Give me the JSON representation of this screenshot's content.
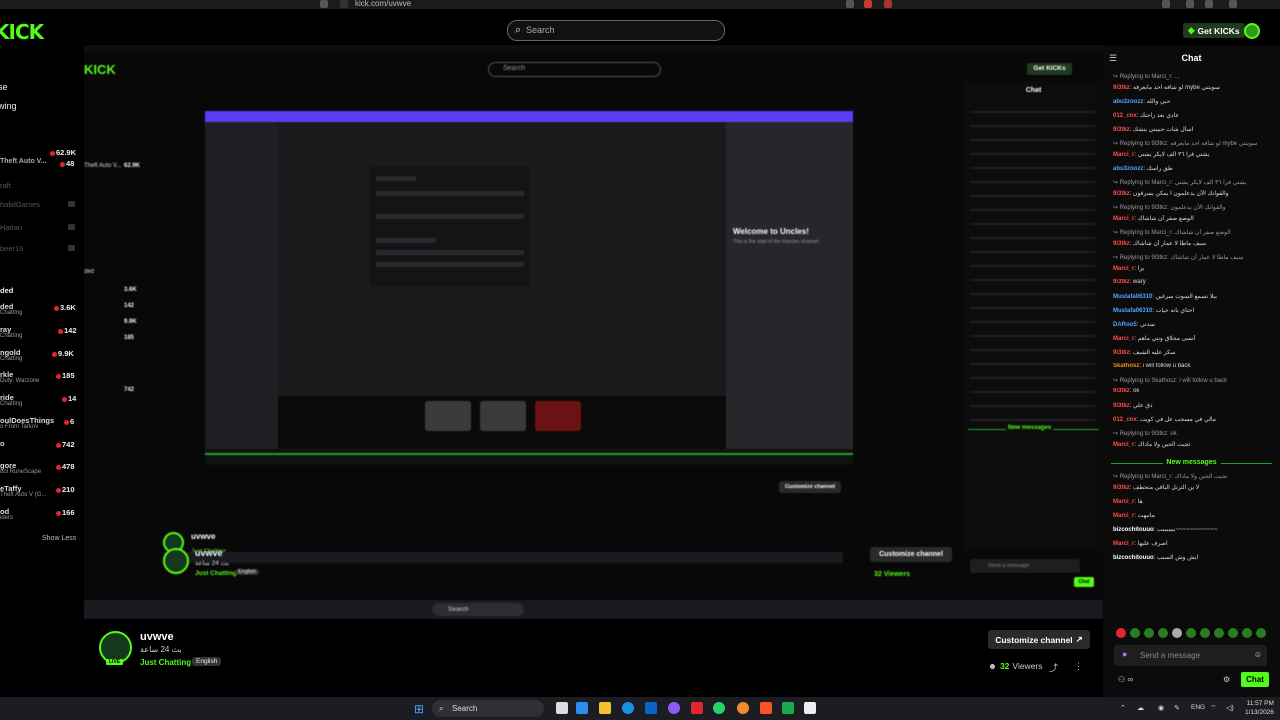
{
  "browser": {
    "url": "kick.com/uvwve"
  },
  "header": {
    "logo": "KICK",
    "search_placeholder": "Search",
    "get_kicks_label": "Get KICKs"
  },
  "sidebar": {
    "top_items": [
      "se",
      "wing"
    ],
    "followed": [
      {
        "name": "",
        "viewers": "62.9K"
      },
      {
        "name": "Theft Auto V...",
        "viewers": "48"
      },
      {
        "name": "raft",
        "viewers": ""
      },
      {
        "name": "halidGames",
        "viewers": ""
      },
      {
        "name": "Hattan",
        "viewers": ""
      },
      {
        "name": "beer16",
        "viewers": ""
      }
    ],
    "recommended_title": "ded",
    "recommended": [
      {
        "name": "ded",
        "sub": "Chatting",
        "viewers": "3.6K"
      },
      {
        "name": "ray",
        "sub": "Chatting",
        "viewers": "142"
      },
      {
        "name": "ngold",
        "sub": "Chatting",
        "viewers": "9.9K"
      },
      {
        "name": "rkle",
        "sub": "Duty: Warzone",
        "viewers": "185"
      },
      {
        "name": "ride",
        "sub": "Chatting",
        "viewers": "14"
      },
      {
        "name": "oulDoesThings",
        "sub": "o From Tarkov",
        "viewers": "6"
      },
      {
        "name": "o",
        "sub": "",
        "viewers": "742"
      },
      {
        "name": "gore",
        "sub": "ool RuneScape",
        "viewers": "478"
      },
      {
        "name": "eTaffy",
        "sub": "Theft Auto V (G...",
        "viewers": "210"
      },
      {
        "name": "od",
        "sub": "iders",
        "viewers": "166"
      }
    ],
    "show_less": "Show Less"
  },
  "nested": {
    "inner_welcome": "Welcome to Uncles!",
    "inner_welcome_sub": "This is the start of the #uncles channel.",
    "taskbar_search": "Search",
    "chat_title": "Chat",
    "customize_label": "Customize channel",
    "viewers_label": "32 Viewers",
    "send_placeholder": "Send a message",
    "chat_btn": "Chat",
    "new_messages": "New messages"
  },
  "channel": {
    "name": "uvwve",
    "subtitle": "بث 24 ساعة",
    "category": "Just Chatting",
    "language": "English",
    "live_badge": "LIVE",
    "customize_label": "Customize channel",
    "viewers_count": "32",
    "viewers_label": "Viewers"
  },
  "chat": {
    "title": "Chat",
    "messages": [
      {
        "type": "reply",
        "text": "Replying to Marci_r: ..."
      },
      {
        "type": "msg",
        "user": "9i3tkz",
        "color": "#ff4d4d",
        "text": "لو شافه احد مايغرقه mybe سويتني"
      },
      {
        "type": "msg",
        "user": "abu3zoozz",
        "color": "#4da6ff",
        "text": "حبي والله"
      },
      {
        "type": "msg",
        "user": "012_cnx",
        "color": "#ff4d4d",
        "text": "عادي بعد راحتك"
      },
      {
        "type": "msg",
        "user": "9i3tkz",
        "color": "#ff4d4d",
        "text": "اسأل شات حبيبتي ينشك"
      },
      {
        "type": "reply",
        "text": "Replying to 9i3tkz: لو شافه احد مايغرقه mybe سويتني"
      },
      {
        "type": "msg",
        "user": "Marci_r",
        "color": "#ff4d4d",
        "text": "يشتي قرآ ٣٦ الف لايكر يشتي"
      },
      {
        "type": "msg",
        "user": "abu3zoozz",
        "color": "#4da6ff",
        "text": "طق راسك"
      },
      {
        "type": "reply",
        "text": "Replying to Marci_r: يشتي قرآ ٣٦ الف لايكر يشتي"
      },
      {
        "type": "msg",
        "user": "9i3tkz",
        "color": "#ff4d4d",
        "text": "والقوانك الآن يدعلمون آ يمكن يسرقون"
      },
      {
        "type": "reply",
        "text": "Replying to 9i3tkz: والقوانك الآن يدعلمون"
      },
      {
        "type": "msg",
        "user": "Marci_r",
        "color": "#ff4d4d",
        "text": "الوضع صفر أن شاشاك"
      },
      {
        "type": "reply",
        "text": "Replying to Marci_r: الوضع صفر أن شاشاك"
      },
      {
        "type": "msg",
        "user": "9i3tkz",
        "color": "#ff4d4d",
        "text": "سيف ماطا لا عمار أن شاشاك"
      },
      {
        "type": "reply",
        "text": "Replying to 9i3tkz: سيف ماطا لا عمار أن شاشاك"
      },
      {
        "type": "msg",
        "user": "Marci_r",
        "color": "#ff4d4d",
        "text": "برا"
      },
      {
        "type": "msg",
        "user": "9i3tkz",
        "color": "#ff4d4d",
        "text": "wary"
      },
      {
        "type": "msg",
        "user": "Mustafa06310",
        "color": "#4da6ff",
        "text": "يبلا نسمع السوت سرغين"
      },
      {
        "type": "msg",
        "user": "Mustafa06310",
        "color": "#4da6ff",
        "text": "احتاي بانه حيات"
      },
      {
        "type": "msg",
        "user": "DARoo5",
        "color": "#4da6ff",
        "text": "سدتي"
      },
      {
        "type": "msg",
        "user": "Marci_r",
        "color": "#ff4d4d",
        "text": "أنسى مجلاق ونتي ماهم"
      },
      {
        "type": "msg",
        "user": "9i3tkz",
        "color": "#ff4d4d",
        "text": "سكر عليه الشيف"
      },
      {
        "type": "msg",
        "user": "Skathosz",
        "color": "#ff8c1a",
        "text": "i will follow u back"
      },
      {
        "type": "reply",
        "text": "Replying to Skathosz: i will follow u back"
      },
      {
        "type": "msg",
        "user": "9i3tkz",
        "color": "#ff4d4d",
        "text": "ok"
      },
      {
        "type": "msg",
        "user": "9i3tkz",
        "color": "#ff4d4d",
        "text": "دق علي"
      },
      {
        "type": "msg",
        "user": "012_cnx",
        "color": "#ff4d4d",
        "text": "مالي في مسحب عل في كويت"
      },
      {
        "type": "reply",
        "text": "Replying to 9i3tkz: ok"
      },
      {
        "type": "msg",
        "user": "Marci_r",
        "color": "#ff4d4d",
        "text": "تجيت الحين ولا ماداك"
      }
    ],
    "new_messages_label": "New messages",
    "after_new": [
      {
        "type": "reply",
        "text": "Replying to Marci_r: تجيت الحين ولا ماداك"
      },
      {
        "type": "msg",
        "user": "9i3tkz",
        "color": "#ff4d4d",
        "text": "لا ين الترتل الباقي متحطف"
      },
      {
        "type": "msg",
        "user": "Marci_r",
        "color": "#ff4d4d",
        "text": "ها"
      },
      {
        "type": "msg",
        "user": "Marci_r",
        "color": "#ff4d4d",
        "text": "ماتبهت"
      },
      {
        "type": "msg",
        "user": "bizcochitouuo",
        "color": "#ffffff",
        "text": "بببببببب~~~~~~~~~~~~"
      },
      {
        "type": "msg",
        "user": "Marci_r",
        "color": "#ff4d4d",
        "text": "اصرف عليها"
      },
      {
        "type": "msg",
        "user": "bizcochitouuo",
        "color": "#ffffff",
        "text": "ايش وش السبب"
      }
    ],
    "input_placeholder": "Send a message",
    "send_label": "Chat"
  },
  "taskbar": {
    "search_label": "Search",
    "lang": "ENG",
    "time": "11:57 PM",
    "date": "1/13/2026"
  }
}
